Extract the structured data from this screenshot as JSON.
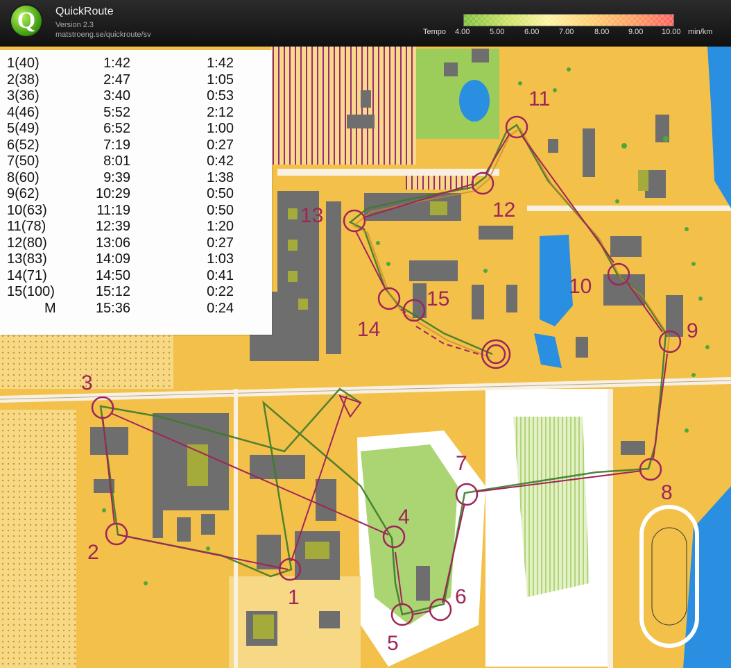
{
  "app": {
    "title": "QuickRoute",
    "version": "Version 2.3",
    "url": "matstroeng.se/quickroute/sv"
  },
  "tempo": {
    "label": "Tempo",
    "ticks": [
      "4.00",
      "5.00",
      "6.00",
      "7.00",
      "8.00",
      "9.00",
      "10.00"
    ],
    "unit": "min/km",
    "colors": [
      "#7fbf3a",
      "#c8e060",
      "#fff2a0",
      "#ffd070",
      "#ffa060",
      "#ff6060"
    ]
  },
  "splits": [
    {
      "control": "1(40)",
      "time": "1:42",
      "leg": "1:42"
    },
    {
      "control": "2(38)",
      "time": "2:47",
      "leg": "1:05"
    },
    {
      "control": "3(36)",
      "time": "3:40",
      "leg": "0:53"
    },
    {
      "control": "4(46)",
      "time": "5:52",
      "leg": "2:12"
    },
    {
      "control": "5(49)",
      "time": "6:52",
      "leg": "1:00"
    },
    {
      "control": "6(52)",
      "time": "7:19",
      "leg": "0:27"
    },
    {
      "control": "7(50)",
      "time": "8:01",
      "leg": "0:42"
    },
    {
      "control": "8(60)",
      "time": "9:39",
      "leg": "1:38"
    },
    {
      "control": "9(62)",
      "time": "10:29",
      "leg": "0:50"
    },
    {
      "control": "10(63)",
      "time": "11:19",
      "leg": "0:50"
    },
    {
      "control": "11(78)",
      "time": "12:39",
      "leg": "1:20"
    },
    {
      "control": "12(80)",
      "time": "13:06",
      "leg": "0:27"
    },
    {
      "control": "13(83)",
      "time": "14:09",
      "leg": "1:03"
    },
    {
      "control": "14(71)",
      "time": "14:50",
      "leg": "0:41"
    },
    {
      "control": "15(100)",
      "time": "15:12",
      "leg": "0:22"
    },
    {
      "control": "M",
      "time": "15:36",
      "leg": "0:24"
    }
  ],
  "control_labels": [
    "1",
    "2",
    "3",
    "4",
    "5",
    "6",
    "7",
    "8",
    "9",
    "10",
    "11",
    "12",
    "13",
    "14",
    "15"
  ],
  "colors": {
    "course": "#a0235a",
    "route": "#3d7a2a",
    "open_land": "#f3c04a",
    "forest": "#ffffff",
    "building": "#6e6e6e",
    "water": "#2a8fe0",
    "green": "#9ccd5a"
  }
}
